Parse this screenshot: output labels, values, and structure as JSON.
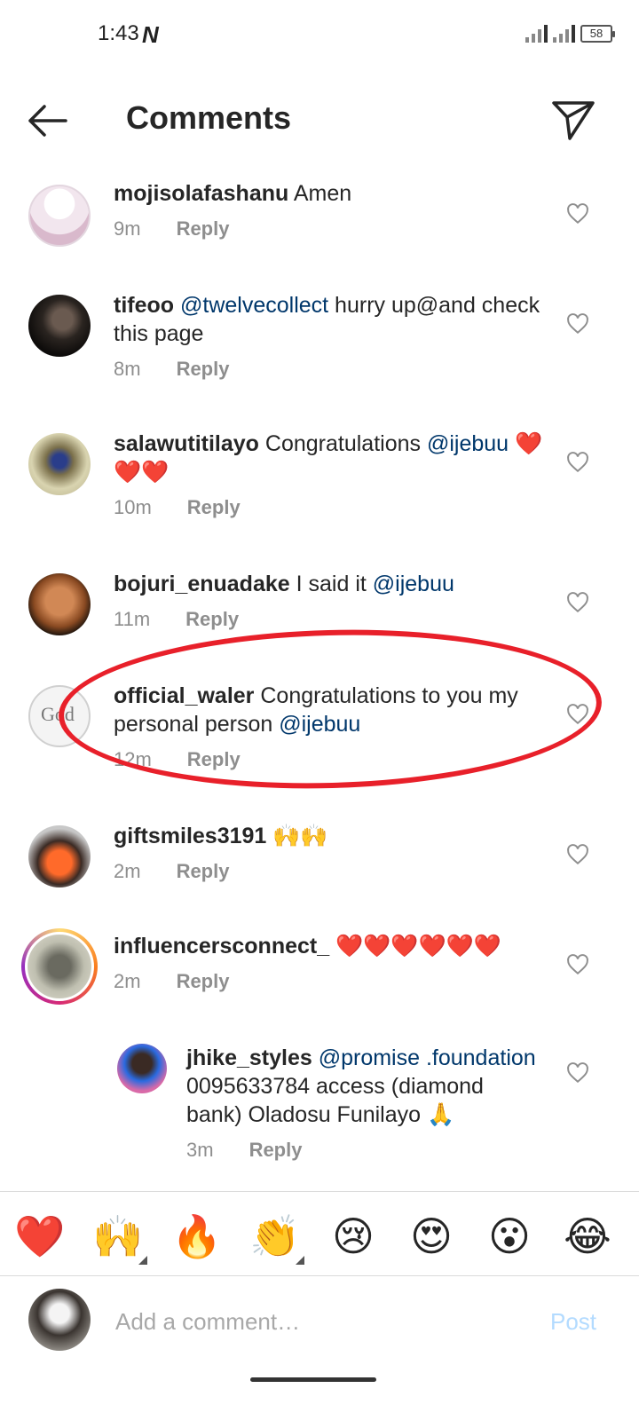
{
  "status_bar": {
    "time": "1:43",
    "carrier_icon": "N",
    "battery": "58"
  },
  "header": {
    "title": "Comments"
  },
  "comments": [
    {
      "username": "mojisolafashanu",
      "text": "Amen",
      "mentions": "",
      "time": "9m",
      "reply": "Reply"
    },
    {
      "username": "tifeoo",
      "mention": "@twelvecollect",
      "text": " hurry up@and check this page",
      "time": "8m",
      "reply": "Reply"
    },
    {
      "username": "salawutitilayo",
      "text": "Congratulations ",
      "mention": "@ijebuu",
      "emojis": "❤️❤️❤️",
      "time": "10m",
      "reply": "Reply"
    },
    {
      "username": "bojuri_enuadake",
      "text": "I said it ",
      "mention": "@ijebuu",
      "time": "11m",
      "reply": "Reply"
    },
    {
      "username": "official_waler",
      "text": "Congratulations to you my personal person ",
      "mention": "@ijebuu",
      "time": "12m",
      "reply": "Reply"
    },
    {
      "username": "giftsmiles3191",
      "text": "🙌🙌",
      "time": "2m",
      "reply": "Reply"
    },
    {
      "username": "influencersconnect_",
      "text": "❤️❤️❤️❤️❤️❤️",
      "time": "2m",
      "reply": "Reply"
    }
  ],
  "reply_comment": {
    "username": "jhike_styles",
    "mention": "@promise .foundation",
    "text": "  0095633784 access (diamond bank) Oladosu Funilayo 🙏",
    "time": "3m",
    "reply": "Reply"
  },
  "emoji_bar": [
    "❤️",
    "🙌",
    "🔥",
    "👏",
    "😢",
    "😍",
    "😮",
    "😂"
  ],
  "composer": {
    "placeholder": "Add a comment…",
    "post_label": "Post"
  },
  "colors": {
    "mention": "#00376b",
    "post_disabled": "#b3dbff",
    "highlight": "#e8202a"
  }
}
